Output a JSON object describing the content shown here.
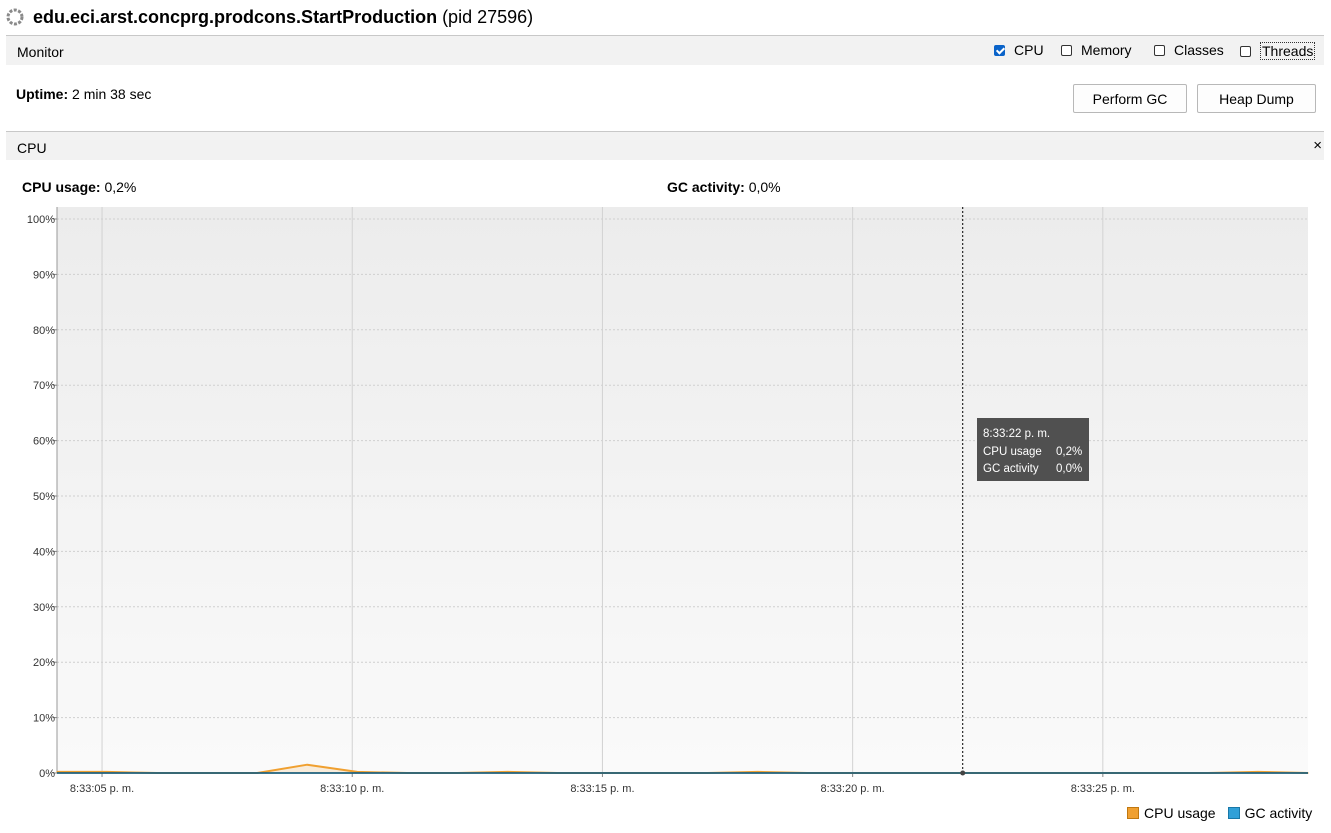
{
  "window": {
    "app_title": "edu.eci.arst.concprg.prodcons.StartProduction",
    "pid_label": "(pid 27596)",
    "icon": "loading-spinner-icon"
  },
  "monitor_bar": {
    "label": "Monitor",
    "checkboxes": [
      {
        "label": "CPU",
        "checked": true
      },
      {
        "label": "Memory",
        "checked": false
      },
      {
        "label": "Classes",
        "checked": false
      },
      {
        "label": "Threads",
        "checked": false
      }
    ]
  },
  "uptime": {
    "label": "Uptime:",
    "value": "2 min 38 sec"
  },
  "buttons": {
    "perform_gc": "Perform GC",
    "heap_dump": "Heap Dump"
  },
  "cpu_panel": {
    "title": "CPU",
    "close_glyph": "×",
    "cpu_usage_label": "CPU usage:",
    "cpu_usage_value": "0,2%",
    "gc_activity_label": "GC activity:",
    "gc_activity_value": "0,0%"
  },
  "tooltip": {
    "time": "8:33:22 p. m.",
    "cpu_label": "CPU usage",
    "cpu_value": "0,2%",
    "gc_label": "GC activity",
    "gc_value": "0,0%"
  },
  "colors": {
    "cpu": "#f0a030",
    "gc": "#30a0d8",
    "crosshair": "#000000"
  },
  "chart_data": {
    "type": "area",
    "title": "",
    "xlabel": "",
    "ylabel": "",
    "x_ticks": [
      "8:33:05 p. m.",
      "8:33:10 p. m.",
      "8:33:15 p. m.",
      "8:33:20 p. m.",
      "8:33:25 p. m."
    ],
    "y_ticks": [
      "0%",
      "10%",
      "20%",
      "30%",
      "40%",
      "50%",
      "60%",
      "70%",
      "80%",
      "90%",
      "100%"
    ],
    "ylim": [
      0,
      100
    ],
    "x_range_seconds": [
      4.1,
      29.1
    ],
    "grid": true,
    "legend": "bottom-right",
    "series": [
      {
        "name": "CPU usage",
        "x": [
          4.1,
          5.1,
          6.1,
          7.1,
          8.1,
          9.1,
          10.1,
          11.1,
          12.1,
          13.1,
          14.1,
          15.1,
          16.1,
          17.1,
          18.1,
          19.1,
          20.1,
          21.1,
          22.1,
          23.1,
          24.1,
          25.1,
          26.1,
          27.1,
          28.1,
          29.1
        ],
        "values": [
          0.2,
          0.2,
          0,
          0,
          0,
          1.5,
          0.2,
          0,
          0,
          0.2,
          0,
          0,
          0,
          0,
          0.2,
          0,
          0,
          0,
          0,
          0,
          0,
          0,
          0,
          0,
          0.2,
          0
        ]
      },
      {
        "name": "GC activity",
        "x": [
          4.1,
          29.1
        ],
        "values": [
          0,
          0
        ]
      }
    ],
    "crosshair_x": 22.2
  }
}
